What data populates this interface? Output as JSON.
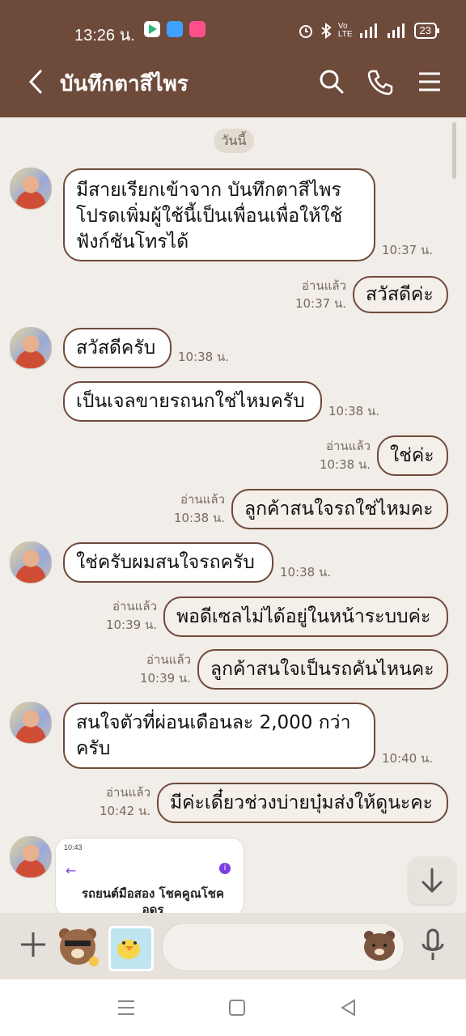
{
  "status_bar": {
    "time": "13:26 น.",
    "battery": "23"
  },
  "header": {
    "title": "บันทึกตาสีไพร"
  },
  "chat": {
    "date_divider": "วันนี้",
    "read_label": "อ่านแล้ว",
    "messages": [
      {
        "side": "in",
        "lines": [
          "มีสายเรียกเข้าจาก บันทึกตาสีไพร",
          "โปรดเพิ่มผู้ใช้นี้เป็นเพื่อนเพื่อให้ใช้",
          "ฟังก์ชันโทรได้"
        ],
        "time": "10:37 น."
      },
      {
        "side": "out",
        "text": "สวัสดีค่ะ",
        "time": "10:37 น.",
        "read": true
      },
      {
        "side": "in",
        "text": "สวัสดีครับ",
        "time": "10:38 น."
      },
      {
        "side": "in",
        "text": "เป็นเจลขายรถนกใช่ไหมครับ",
        "time": "10:38 น."
      },
      {
        "side": "out",
        "text": "ใช่ค่ะ",
        "time": "10:38 น.",
        "read": true
      },
      {
        "side": "out",
        "text": "ลูกค้าสนใจรถใช่ไหมคะ",
        "time": "10:38 น.",
        "read": true
      },
      {
        "side": "in",
        "text": "ใช่ครับผมสนใจรถครับ",
        "time": "10:38 น."
      },
      {
        "side": "out",
        "text": "พอดีเซลไม่ได้อยู่ในหน้าระบบค่ะ",
        "time": "10:39 น.",
        "read": true
      },
      {
        "side": "out",
        "text": "ลูกค้าสนใจเป็นรถคันไหนคะ",
        "time": "10:39 น.",
        "read": true
      },
      {
        "side": "in",
        "lines": [
          "สนใจตัวที่ผ่อนเดือนละ 2,000 กว่า",
          "ครับ"
        ],
        "time": "10:40 น."
      },
      {
        "side": "out",
        "text": "มีค่ะเดี๋ยวช่วงบ่ายบุ๋มส่งให้ดูนะคะ",
        "time": "10:42 น.",
        "read": true
      }
    ],
    "image_preview": {
      "status_time": "10:43",
      "title": "รถยนต์มือสอง โชคคูณโชค อดร"
    }
  },
  "colors": {
    "header_bg": "#6e4a3a",
    "chat_bg": "#f1ede8",
    "bubble_border": "#6e4a3a"
  }
}
